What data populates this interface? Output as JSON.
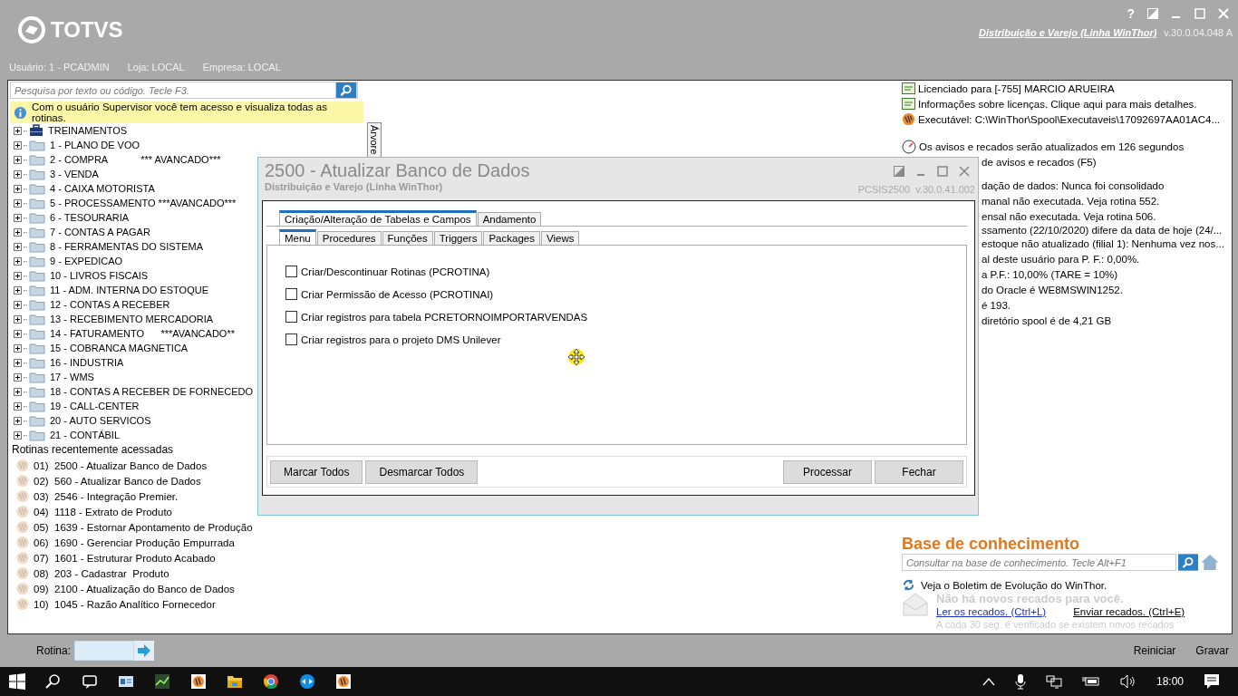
{
  "app": {
    "logo": "TOTVS",
    "help": "?",
    "product_link": "Distribuição e Varejo (Linha WinThor)",
    "version": "v.30.0.04.048 A"
  },
  "user_bar": [
    "Usuário: 1 - PCADMIN",
    "Loja: LOCAL",
    "Empresa: LOCAL"
  ],
  "search": {
    "placeholder": "Pesquisa por texto ou código. Tecle F3."
  },
  "info": "Com o usuário Supervisor você tem acesso e visualiza todas as rotinas.",
  "side_tab": "Árvore",
  "tree": [
    {
      "label": "TREINAMENTOS",
      "kind": "toolbox",
      "expanded": false
    },
    {
      "label": "1 - PLANO DE VOO",
      "kind": "folder",
      "expanded": false
    },
    {
      "label": "2 - COMPRA            *** AVANCADO***",
      "kind": "folder",
      "expanded": false
    },
    {
      "label": "3 - VENDA",
      "kind": "folder",
      "expanded": false
    },
    {
      "label": "4 - CAIXA MOTORISTA",
      "kind": "folder",
      "expanded": false
    },
    {
      "label": "5 - PROCESSAMENTO ***AVANCADO***",
      "kind": "folder",
      "expanded": false
    },
    {
      "label": "6 - TESOURARIA",
      "kind": "folder",
      "expanded": false
    },
    {
      "label": "7 - CONTAS A PAGAR",
      "kind": "folder",
      "expanded": false
    },
    {
      "label": "8 - FERRAMENTAS DO SISTEMA",
      "kind": "folder",
      "expanded": false
    },
    {
      "label": "9 - EXPEDICAO",
      "kind": "folder",
      "expanded": false
    },
    {
      "label": "10 - LIVROS FISCAIS",
      "kind": "folder",
      "expanded": false
    },
    {
      "label": "11 - ADM. INTERNA DO ESTOQUE",
      "kind": "folder",
      "expanded": false
    },
    {
      "label": "12 - CONTAS A RECEBER",
      "kind": "folder",
      "expanded": false
    },
    {
      "label": "13 - RECEBIMENTO MERCADORIA",
      "kind": "folder",
      "expanded": false
    },
    {
      "label": "14 - FATURAMENTO      ***AVANCADO**",
      "kind": "folder",
      "expanded": false
    },
    {
      "label": "15 - COBRANCA MAGNETICA",
      "kind": "folder",
      "expanded": false
    },
    {
      "label": "16 - INDUSTRIA",
      "kind": "folder",
      "expanded": false
    },
    {
      "label": "17 - WMS",
      "kind": "folder",
      "expanded": false
    },
    {
      "label": "18 - CONTAS A RECEBER DE FORNECEDO",
      "kind": "folder",
      "expanded": false
    },
    {
      "label": "19 - CALL-CENTER",
      "kind": "folder",
      "expanded": false
    },
    {
      "label": "20 - AUTO SERVICOS",
      "kind": "folder",
      "expanded": false
    },
    {
      "label": "21 - CONTÁBIL",
      "kind": "folder",
      "expanded": false
    }
  ],
  "recent": {
    "title": "Rotinas recentemente acessadas",
    "items": [
      "01)  2500 - Atualizar Banco de Dados",
      "02)  560 - Atualizar Banco de Dados",
      "03)  2546 - Integração Premier.",
      "04)  1118 - Extrato de Produto",
      "05)  1639 - Estornar Apontamento de Produção",
      "06)  1690 - Gerenciar Produção Empurrada",
      "07)  1601 - Estruturar Produto Acabado",
      "08)  203 - Cadastrar  Produto",
      "09)  2100 - Atualização do Banco de Dados",
      "10)  1045 - Razão Analítico Fornecedor"
    ]
  },
  "routine": {
    "label": "Rotina:"
  },
  "footer_buttons": [
    "Reiniciar",
    "Gravar"
  ],
  "right": {
    "lines": [
      {
        "kind": "license",
        "text": "Licenciado para [-755] MARCIO ARUEIRA"
      },
      {
        "kind": "license",
        "text": "Informações sobre licenças. Clique aqui para mais detalhes."
      },
      {
        "kind": "app",
        "text": "Executável: C:\\WinThor\\Spool\\Executaveis\\17092697AA01AC4..."
      },
      {
        "kind": "gap"
      },
      {
        "kind": "timer",
        "text": "Os avisos e recados serão atualizados em 126 segundos"
      }
    ],
    "partial_lines": [
      "de avisos e recados (F5)"
    ],
    "status_lines": [
      "dação de dados: Nunca foi consolidado",
      "manal não executada. Veja rotina 552.",
      "ensal não executada. Veja rotina 506.",
      "ssamento (22/10/2020) difere da data de hoje (24/...",
      "estoque não atualizado (filial 1): Nenhuma vez nos...",
      "al deste usuário para P. F.: 0,00%.",
      "a P.F.: 10,00% (TARE = 10%)",
      "do Oracle é WE8MSWIN1252.",
      "é 193.",
      "diretório spool é de 4,21 GB"
    ]
  },
  "knowledge": {
    "title": "Base de conhecimento",
    "placeholder": "Consultar na base de conhecimento. Tecle Alt+F1",
    "bulletin": "Veja o Boletim de Evolução do WinThor.",
    "no_messages": "Não há novos recados para você.",
    "read_link": "Ler os recados. (Ctrl+L)",
    "send_link": "Enviar recados. (Ctrl+E)",
    "note": "A cada 30 seg. é verificado se existem novos recados"
  },
  "dialog": {
    "title": "2500 - Atualizar Banco de Dados",
    "subtitle": "Distribuição e Varejo (Linha WinThor)",
    "program": "PCSIS2500",
    "version": "v.30.0.41.002",
    "outer_tabs": [
      {
        "label": "Criação/Alteração de Tabelas e Campos",
        "selected": true
      },
      {
        "label": "Andamento",
        "selected": false
      }
    ],
    "inner_tabs": [
      {
        "label": "Menu",
        "selected": true
      },
      {
        "label": "Procedures",
        "selected": false
      },
      {
        "label": "Funções",
        "selected": false
      },
      {
        "label": "Triggers",
        "selected": false
      },
      {
        "label": "Packages",
        "selected": false
      },
      {
        "label": "Views",
        "selected": false
      }
    ],
    "options": [
      {
        "label": "Criar/Descontinuar Rotinas (PCROTINA)",
        "checked": false
      },
      {
        "label": "Criar Permissão de Acesso (PCROTINAI)",
        "checked": false
      },
      {
        "label": "Criar registros para tabela PCRETORNOIMPORTARVENDAS",
        "checked": false
      },
      {
        "label": "Criar registros para o projeto DMS Unilever",
        "checked": false
      }
    ],
    "buttons_left": [
      "Marcar Todos",
      "Desmarcar Todos"
    ],
    "buttons_right": [
      "Processar",
      "Fechar"
    ]
  },
  "taskbar": {
    "time": "18:00"
  }
}
